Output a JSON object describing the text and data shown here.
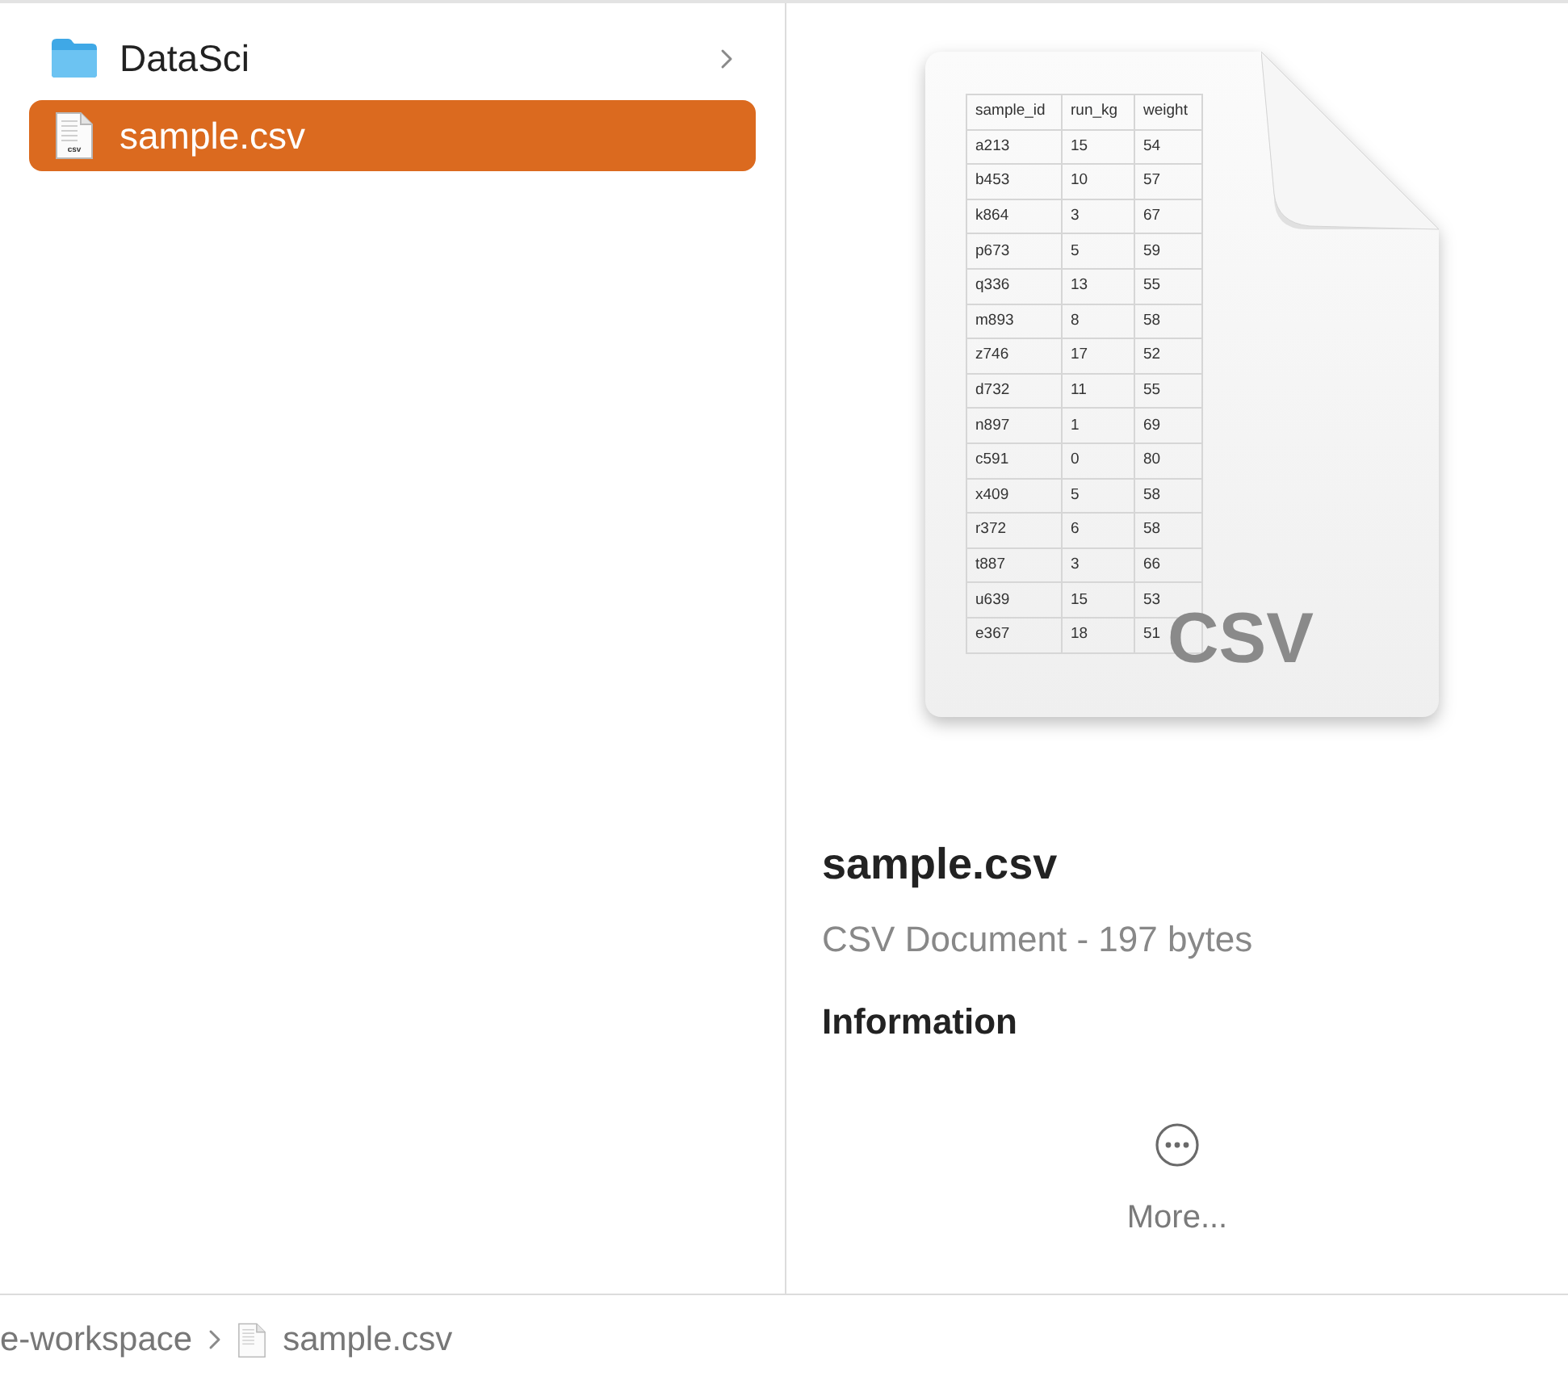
{
  "sidebar": {
    "items": [
      {
        "name": "DataSci",
        "kind": "folder",
        "selected": false,
        "has_children": true
      },
      {
        "name": "sample.csv",
        "kind": "file",
        "selected": true,
        "has_children": false,
        "icon_label": "csv"
      }
    ]
  },
  "preview": {
    "thumbnail": {
      "columns": [
        "sample_id",
        "run_kg",
        "weight"
      ],
      "rows": [
        [
          "a213",
          "15",
          "54"
        ],
        [
          "b453",
          "10",
          "57"
        ],
        [
          "k864",
          "3",
          "67"
        ],
        [
          "p673",
          "5",
          "59"
        ],
        [
          "q336",
          "13",
          "55"
        ],
        [
          "m893",
          "8",
          "58"
        ],
        [
          "z746",
          "17",
          "52"
        ],
        [
          "d732",
          "11",
          "55"
        ],
        [
          "n897",
          "1",
          "69"
        ],
        [
          "c591",
          "0",
          "80"
        ],
        [
          "x409",
          "5",
          "58"
        ],
        [
          "r372",
          "6",
          "58"
        ],
        [
          "t887",
          "3",
          "66"
        ],
        [
          "u639",
          "15",
          "53"
        ],
        [
          "e367",
          "18",
          "51"
        ]
      ],
      "badge": "CSV"
    },
    "title": "sample.csv",
    "subtitle": "CSV Document - 197 bytes",
    "section": "Information",
    "more": "More..."
  },
  "path_bar": {
    "items": [
      {
        "text": "e-workspace",
        "kind": "folder"
      },
      {
        "text": "sample.csv",
        "kind": "file"
      }
    ]
  }
}
